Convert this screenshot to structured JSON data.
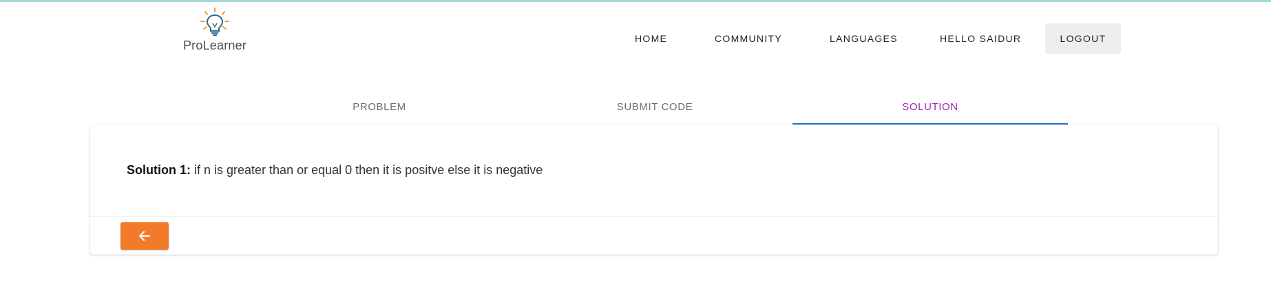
{
  "brand": {
    "name": "ProLearner",
    "logo_icon": "lightbulb-icon",
    "colors": {
      "bulb": "#2f6b8a",
      "rays": "#f39a2b"
    }
  },
  "nav": {
    "home": "HOME",
    "community": "COMMUNITY",
    "languages": "LANGUAGES",
    "greeting": "HELLO SAIDUR",
    "logout": "LOGOUT"
  },
  "tabs": {
    "problem": "PROBLEM",
    "submit_code": "SUBMIT CODE",
    "solution": "SOLUTION",
    "active": "SOLUTION"
  },
  "solution": {
    "label": "Solution 1:",
    "text": " if n is greater than or equal 0 then it is positve else it is negative"
  },
  "back_button": {
    "icon": "arrow-left-icon",
    "color": "#f47a2b"
  },
  "colors": {
    "accent_tab": "#a125b5",
    "indicator": "#1f6fd0",
    "topline": "#a6dad8"
  }
}
